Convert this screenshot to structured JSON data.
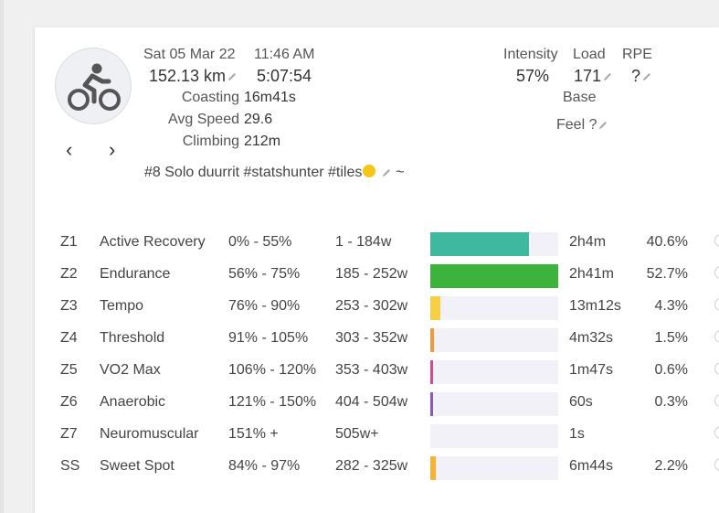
{
  "header": {
    "date": "Sat 05 Mar 22",
    "time": "11:46 AM",
    "distance": "152.13 km",
    "duration": "5:07:54",
    "stats": [
      {
        "label": "Coasting",
        "value": "16m41s"
      },
      {
        "label": "Avg Speed",
        "value": "29.6"
      },
      {
        "label": "Climbing",
        "value": "212m"
      }
    ],
    "tags": "#8 Solo duurrit #statshunter #tiles",
    "tags_suffix": "~",
    "metrics": {
      "intensity_label": "Intensity",
      "intensity_value": "57%",
      "load_label": "Load",
      "load_value": "171",
      "rpe_label": "RPE",
      "rpe_value": "?",
      "base_label": "Base",
      "feel_label": "Feel ?"
    },
    "nav": {
      "prev": "‹",
      "next": "›"
    }
  },
  "zones": [
    {
      "id": "Z1",
      "name": "Active Recovery",
      "pct": "0% - 55%",
      "watts": "1 - 184w",
      "time": "2h4m",
      "share": "40.6%",
      "fill": 0.77,
      "color": "#3fb8a0"
    },
    {
      "id": "Z2",
      "name": "Endurance",
      "pct": "56% - 75%",
      "watts": "185 - 252w",
      "time": "2h41m",
      "share": "52.7%",
      "fill": 1.0,
      "color": "#3cb43c"
    },
    {
      "id": "Z3",
      "name": "Tempo",
      "pct": "76% - 90%",
      "watts": "253 - 302w",
      "time": "13m12s",
      "share": "4.3%",
      "fill": 0.08,
      "color": "#f7cf45"
    },
    {
      "id": "Z4",
      "name": "Threshold",
      "pct": "91% - 105%",
      "watts": "303 - 352w",
      "time": "4m32s",
      "share": "1.5%",
      "fill": 0.03,
      "color": "#f39a3b"
    },
    {
      "id": "Z5",
      "name": "VO2 Max",
      "pct": "106% - 120%",
      "watts": "353 - 403w",
      "time": "1m47s",
      "share": "0.6%",
      "fill": 0.012,
      "color": "#e0448c"
    },
    {
      "id": "Z6",
      "name": "Anaerobic",
      "pct": "121% - 150%",
      "watts": "404 - 504w",
      "time": "60s",
      "share": "0.3%",
      "fill": 0.009,
      "color": "#8a55c6"
    },
    {
      "id": "Z7",
      "name": "Neuromuscular",
      "pct": "151% +",
      "watts": "505w+",
      "time": "1s",
      "share": "",
      "fill": 0,
      "color": "#8a55c6"
    },
    {
      "id": "SS",
      "name": "Sweet Spot",
      "pct": "84% - 97%",
      "watts": "282 - 325w",
      "time": "6m44s",
      "share": "2.2%",
      "fill": 0.04,
      "color": "#f7b233"
    }
  ]
}
